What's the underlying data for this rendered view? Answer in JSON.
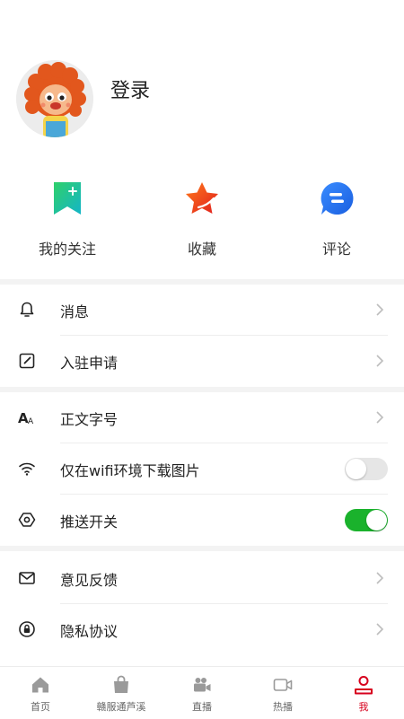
{
  "profile": {
    "login_label": "登录"
  },
  "quick_actions": [
    {
      "label": "我的关注",
      "icon": "bookmark-icon"
    },
    {
      "label": "收藏",
      "icon": "star-icon"
    },
    {
      "label": "评论",
      "icon": "comment-icon"
    }
  ],
  "menu": {
    "messages": "消息",
    "apply": "入驻申请",
    "font_size": "正文字号",
    "wifi_only": "仅在wifi环境下载图片",
    "push": "推送开关",
    "feedback": "意见反馈",
    "privacy": "隐私协议"
  },
  "toggles": {
    "wifi_only": false,
    "push": true
  },
  "tabs": [
    {
      "label": "首页",
      "icon": "home-icon",
      "active": false
    },
    {
      "label": "赣服通芦溪",
      "icon": "bag-icon",
      "active": false
    },
    {
      "label": "直播",
      "icon": "video-camera-icon",
      "active": false
    },
    {
      "label": "热播",
      "icon": "camcorder-icon",
      "active": false
    },
    {
      "label": "我",
      "icon": "person-icon",
      "active": true
    }
  ],
  "colors": {
    "accent": "#d7001d",
    "toggle_on": "#1ab22c",
    "toggle_off": "#e6e6e6",
    "tab_inactive": "#9a9a9a"
  }
}
